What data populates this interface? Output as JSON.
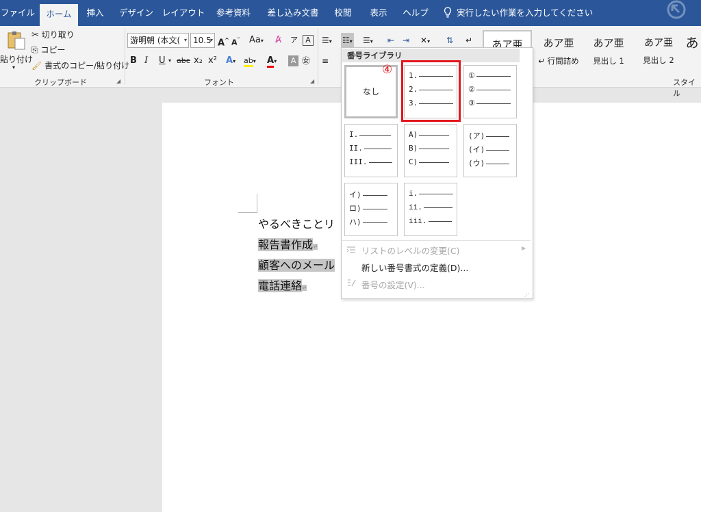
{
  "tabs": [
    "ファイル",
    "ホーム",
    "挿入",
    "デザイン",
    "レイアウト",
    "参考資料",
    "差し込み文書",
    "校閲",
    "表示",
    "ヘルプ"
  ],
  "active_tab": "ホーム",
  "tell_me": "実行したい作業を入力してください",
  "clipboard": {
    "paste": "貼り付け",
    "cut": "切り取り",
    "copy": "コピー",
    "format_painter": "書式のコピー/貼り付け",
    "group_label": "クリップボード"
  },
  "font": {
    "name": "游明朝 (本文(",
    "size": "10.5",
    "case_label": "Aa",
    "bold": "B",
    "italic": "I",
    "underline": "U",
    "strike": "abc",
    "subscript": "x₂",
    "superscript": "x²",
    "group_label": "フォント"
  },
  "styles": {
    "items": [
      {
        "preview": "あア亜",
        "name": ""
      },
      {
        "preview": "あア亜",
        "name": "↵ 行間詰め"
      },
      {
        "preview": "あア亜",
        "name": "見出し 1"
      },
      {
        "preview": "あア亜",
        "name": "見出し 2"
      },
      {
        "preview": "あ",
        "name": ""
      }
    ],
    "group_label": "スタイル"
  },
  "document": {
    "lines": [
      "やるべきことリ",
      "報告書作成",
      "顧客へのメール",
      "電話連絡"
    ]
  },
  "numbering_menu": {
    "header": "番号ライブラリ",
    "step_marker": "④",
    "none_label": "なし",
    "formats": [
      [
        "1.",
        "2.",
        "3."
      ],
      [
        "①",
        "②",
        "③"
      ],
      [
        "I.",
        "II.",
        "III."
      ],
      [
        "A)",
        "B)",
        "C)"
      ],
      [
        "(ア)",
        "(イ)",
        "(ウ)"
      ],
      [
        "イ)",
        "ロ)",
        "ハ)"
      ],
      [
        "i.",
        "ii.",
        "iii."
      ]
    ],
    "change_level": "リストのレベルの変更(C)",
    "define_new": "新しい番号書式の定義(D)...",
    "set_value": "番号の設定(V)..."
  },
  "colors": {
    "accent": "#2b579a",
    "highlight_box": "#e3161d",
    "text_highlight": "#c6c6c6"
  }
}
